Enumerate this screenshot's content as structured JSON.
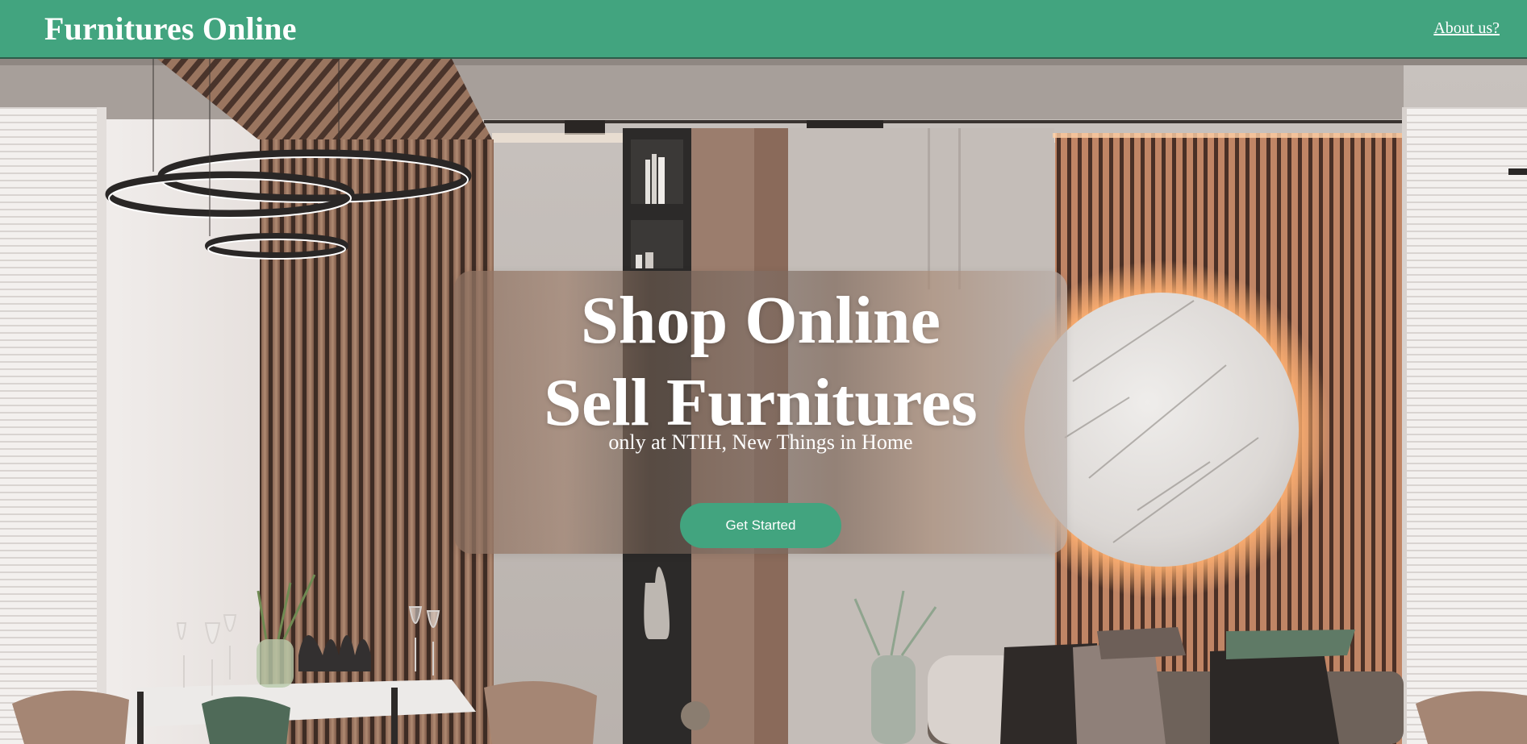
{
  "header": {
    "brand": "Furnitures Online",
    "about_link": "About us?"
  },
  "hero": {
    "title_line1": "Shop Online",
    "title_line2": "Sell Furnitures",
    "subtitle": "only at NTIH, New Things in Home",
    "cta_label": "Get Started",
    "background_image": "modern-dining-room-photo"
  },
  "colors": {
    "accent": "#42a47f",
    "header_border": "#2d5c4a",
    "text_on_accent": "#ffffff"
  }
}
